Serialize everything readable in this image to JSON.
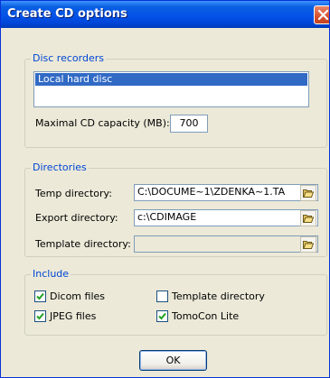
{
  "window": {
    "title": "Create CD options"
  },
  "disc_recorders": {
    "legend": "Disc recorders",
    "items": [
      "Local hard disc"
    ],
    "capacity_label": "Maximal CD capacity (MB):",
    "capacity_value": "700"
  },
  "directories": {
    "legend": "Directories",
    "temp": {
      "label": "Temp directory:",
      "value": "C:\\DOCUME~1\\ZDENKA~1.TA"
    },
    "export": {
      "label": "Export directory:",
      "value": "c:\\CDIMAGE"
    },
    "template": {
      "label": "Template directory:",
      "value": ""
    }
  },
  "include": {
    "legend": "Include",
    "options": [
      {
        "label": "Dicom files",
        "checked": true
      },
      {
        "label": "JPEG files",
        "checked": true
      },
      {
        "label": "Template directory",
        "checked": false
      },
      {
        "label": "TomoCon Lite",
        "checked": true
      }
    ]
  },
  "buttons": {
    "ok": "OK"
  },
  "colors": {
    "title_bar": "#0553E8",
    "group_legend": "#0046D5",
    "selection": "#316AC5",
    "close_button": "#D7512E",
    "check": "#21A121"
  },
  "icons": {
    "close": "close-icon",
    "browse": "folder-open-icon",
    "check": "checkmark-icon"
  }
}
